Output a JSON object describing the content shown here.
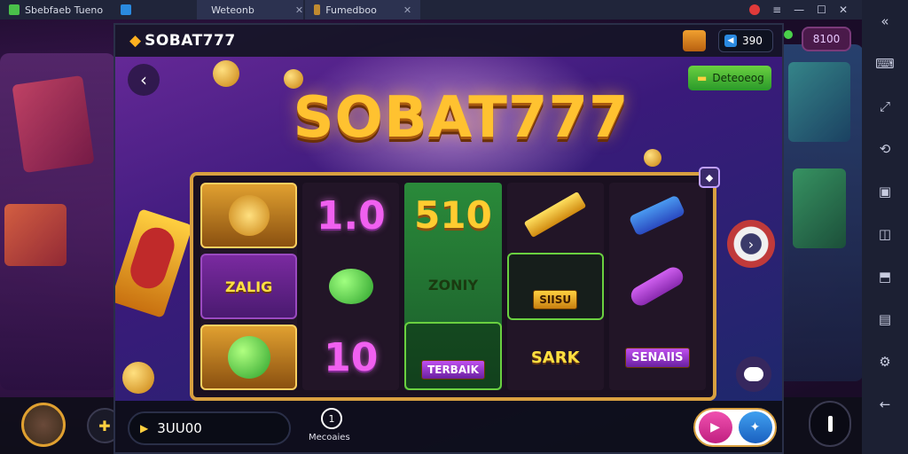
{
  "window": {
    "tabs": [
      {
        "label": "Sbebfaeb Tueno"
      },
      {
        "label": "Weteonb"
      },
      {
        "label": "Fumedboo"
      }
    ]
  },
  "header": {
    "logo_text": "SOBAT777",
    "coins": "390",
    "top_right_badge": "8100"
  },
  "game": {
    "title": "SOBAT777",
    "deposit_label": "Deteoeog",
    "reels": [
      [
        {
          "kind": "icon",
          "icon": "trophy-key-icon"
        },
        {
          "kind": "text",
          "text": "ZALIG"
        },
        {
          "kind": "icon",
          "icon": "green-gem-icon"
        }
      ],
      [
        {
          "kind": "text",
          "text": "1.0"
        },
        {
          "kind": "icon",
          "icon": "green-gem-icon"
        },
        {
          "kind": "text",
          "text": "10"
        }
      ],
      [
        {
          "kind": "text",
          "text": "510"
        },
        {
          "kind": "text",
          "text": "ZONIY"
        },
        {
          "kind": "label",
          "text": "TERBAIK"
        }
      ],
      [
        {
          "kind": "icon",
          "icon": "gold-bar-icon"
        },
        {
          "kind": "label",
          "text": "SIISU"
        },
        {
          "kind": "text",
          "text": "SARK"
        }
      ],
      [
        {
          "kind": "icon",
          "icon": "bottle-icon"
        },
        {
          "kind": "icon",
          "icon": "tube-icon"
        },
        {
          "kind": "label",
          "text": "SENAIIS"
        }
      ]
    ]
  },
  "footer": {
    "balance": "3UU00",
    "bonus_label": "Mecoaies"
  },
  "colors": {
    "accent_gold": "#ffc230",
    "board_border": "#d8a040",
    "deposit_green": "#6ad040",
    "play_pink": "#f050b0",
    "spin_blue": "#40a0f0"
  }
}
